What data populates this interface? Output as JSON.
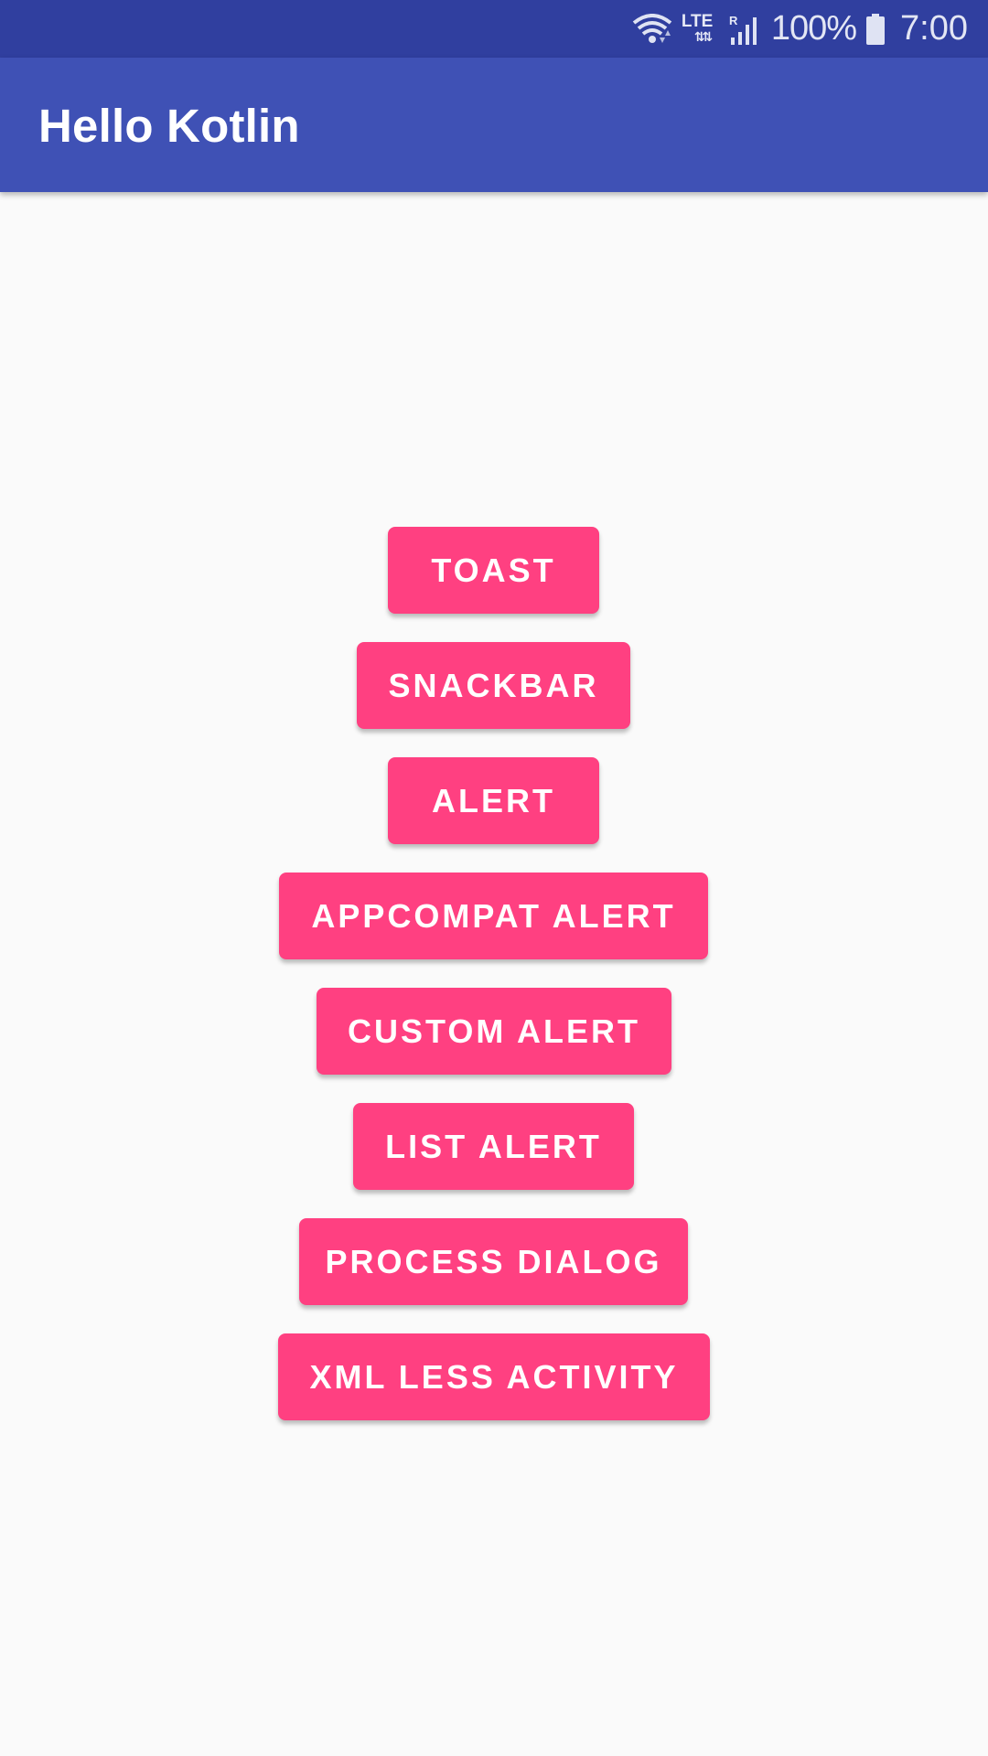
{
  "status_bar": {
    "network_type": "LTE",
    "roaming": "R",
    "battery_percent": "100%",
    "time": "7:00",
    "icons": [
      "wifi-icon",
      "lte-icon",
      "signal-icon",
      "battery-icon"
    ]
  },
  "app_bar": {
    "title": "Hello Kotlin"
  },
  "buttons": [
    "TOAST",
    "SNACKBAR",
    "ALERT",
    "APPCOMPAT ALERT",
    "CUSTOM ALERT",
    "LIST ALERT",
    "PROCESS DIALOG",
    "XML LESS ACTIVITY"
  ],
  "colors": {
    "status_bar": "#303f9f",
    "app_bar": "#3f51b5",
    "button": "#ff4081",
    "background": "#fafafa"
  }
}
